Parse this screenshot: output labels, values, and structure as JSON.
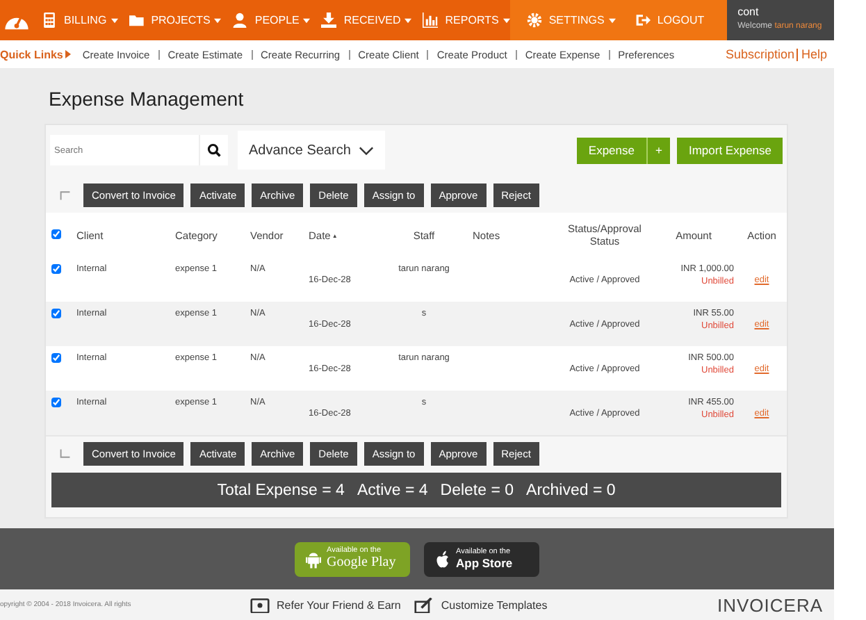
{
  "nav": {
    "items": [
      {
        "label": "BILLING"
      },
      {
        "label": "PROJECTS"
      },
      {
        "label": "PEOPLE"
      },
      {
        "label": "RECEIVED"
      },
      {
        "label": "REPORTS"
      }
    ],
    "settings": "SETTINGS",
    "logout": "LOGOUT",
    "account": "cont",
    "welcome": "Welcome",
    "user": "tarun narang"
  },
  "quick_links": {
    "label": "Quick Links",
    "links": [
      "Create Invoice",
      "Create Estimate",
      "Create Recurring",
      "Create Client",
      "Create Product",
      "Create Expense",
      "Preferences"
    ],
    "subscription": "Subscription",
    "help": "Help"
  },
  "title": "Expense Management",
  "search": {
    "placeholder": "Search"
  },
  "advance_search": "Advance Search",
  "expense_button": "Expense",
  "add_symbol": "+",
  "import_button": "Import Expense",
  "top_actions": [
    "Convert to Invoice",
    "Activate",
    "Archive",
    "Delete",
    "Assign to",
    "Approve",
    "Reject"
  ],
  "table": {
    "all_checked": true,
    "columns": [
      "Client",
      "Category",
      "Vendor",
      "Date",
      "Staff",
      "Notes",
      "Status/Approval Status",
      "Amount",
      "Action"
    ],
    "sort_mark": "▲",
    "rows": [
      {
        "checked": true,
        "client": "Internal",
        "category": "expense 1",
        "vendor": "N/A",
        "date": "16-Dec-28",
        "staff": "tarun narang",
        "status": "Active / Approved",
        "amount": "INR 1,000.00",
        "billing": "Unbilled",
        "action": "edit"
      },
      {
        "checked": true,
        "client": "Internal",
        "category": "expense 1",
        "vendor": "N/A",
        "date": "16-Dec-28",
        "staff": "s",
        "status": "Active / Approved",
        "amount": "INR 55.00",
        "billing": "Unbilled",
        "action": "edit"
      },
      {
        "checked": true,
        "client": "Internal",
        "category": "expense 1",
        "vendor": "N/A",
        "date": "16-Dec-28",
        "staff": "tarun narang",
        "status": "Active / Approved",
        "amount": "INR 500.00",
        "billing": "Unbilled",
        "action": "edit"
      },
      {
        "checked": true,
        "client": "Internal",
        "category": "expense 1",
        "vendor": "N/A",
        "date": "16-Dec-28",
        "staff": "s",
        "status": "Active / Approved",
        "amount": "INR 455.00",
        "billing": "Unbilled",
        "action": "edit"
      }
    ]
  },
  "bottom_actions": [
    "Convert to Invoice",
    "Activate",
    "Archive",
    "Delete",
    "Assign to",
    "Approve",
    "Reject"
  ],
  "totals": [
    "Total Expense = 4",
    "Active = 4",
    "Delete = 0",
    "Archived = 0"
  ],
  "stores": [
    {
      "kind": "google",
      "small": "Available on the",
      "big": "Google Play"
    },
    {
      "kind": "apple",
      "small": "Available on the",
      "big": "App Store"
    }
  ],
  "bottom": {
    "copyright": "opyright © 2004 - 2018 Invoicera. All rights",
    "refer": "Refer Your Friend & Earn",
    "customize": "Customize Templates",
    "logo": "INVOICERA"
  }
}
